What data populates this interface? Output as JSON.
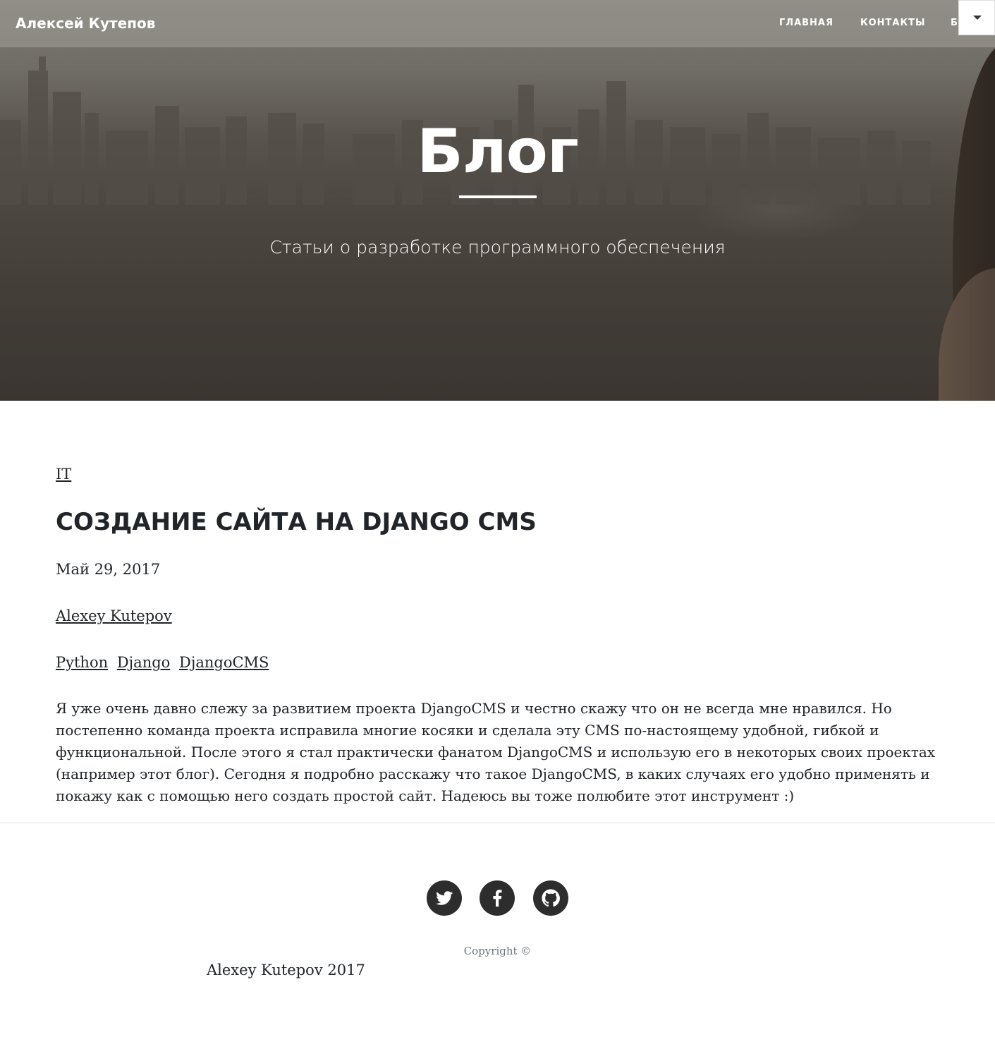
{
  "navbar": {
    "brand": "Алексей Кутепов",
    "links": [
      "ГЛАВНАЯ",
      "КОНТАКТЫ",
      "БЛ"
    ],
    "toggle_icon": "caret-down-icon"
  },
  "hero": {
    "title": "Блог",
    "subtitle": "Статьи о разработке программного обеспечения"
  },
  "post": {
    "category": "IT",
    "title": "СОЗДАНИЕ САЙТА НА DJANGO CMS",
    "date": "Май 29, 2017",
    "author": "Alexey Kutepov",
    "tags": [
      "Python",
      "Django",
      "DjangoCMS"
    ],
    "excerpt": "Я уже очень давно слежу за развитием проекта DjangoCMS и честно скажу что он не всегда мне нравился. Но постепенно команда проекта исправила многие косяки и сделала эту CMS по-настоящему удобной, гибкой и функциональной. После этого я стал практически фанатом DjangoCMS и использую его в некоторых своих проектах (например этот блог). Сегодня я подробно расскажу что такое DjangoCMS, в каких случаях его удобно применять и покажу как с помощью него создать простой сайт. Надеюсь вы тоже полюбите этот инструмент :)"
  },
  "footer": {
    "social": [
      "twitter-icon",
      "facebook-icon",
      "github-icon"
    ],
    "copyright_label": "Copyright ©",
    "copyright_owner": "Alexey Kutepov 2017"
  },
  "colors": {
    "text": "#212529",
    "social_bg": "#2d2d2d",
    "muted": "#6c757d"
  }
}
